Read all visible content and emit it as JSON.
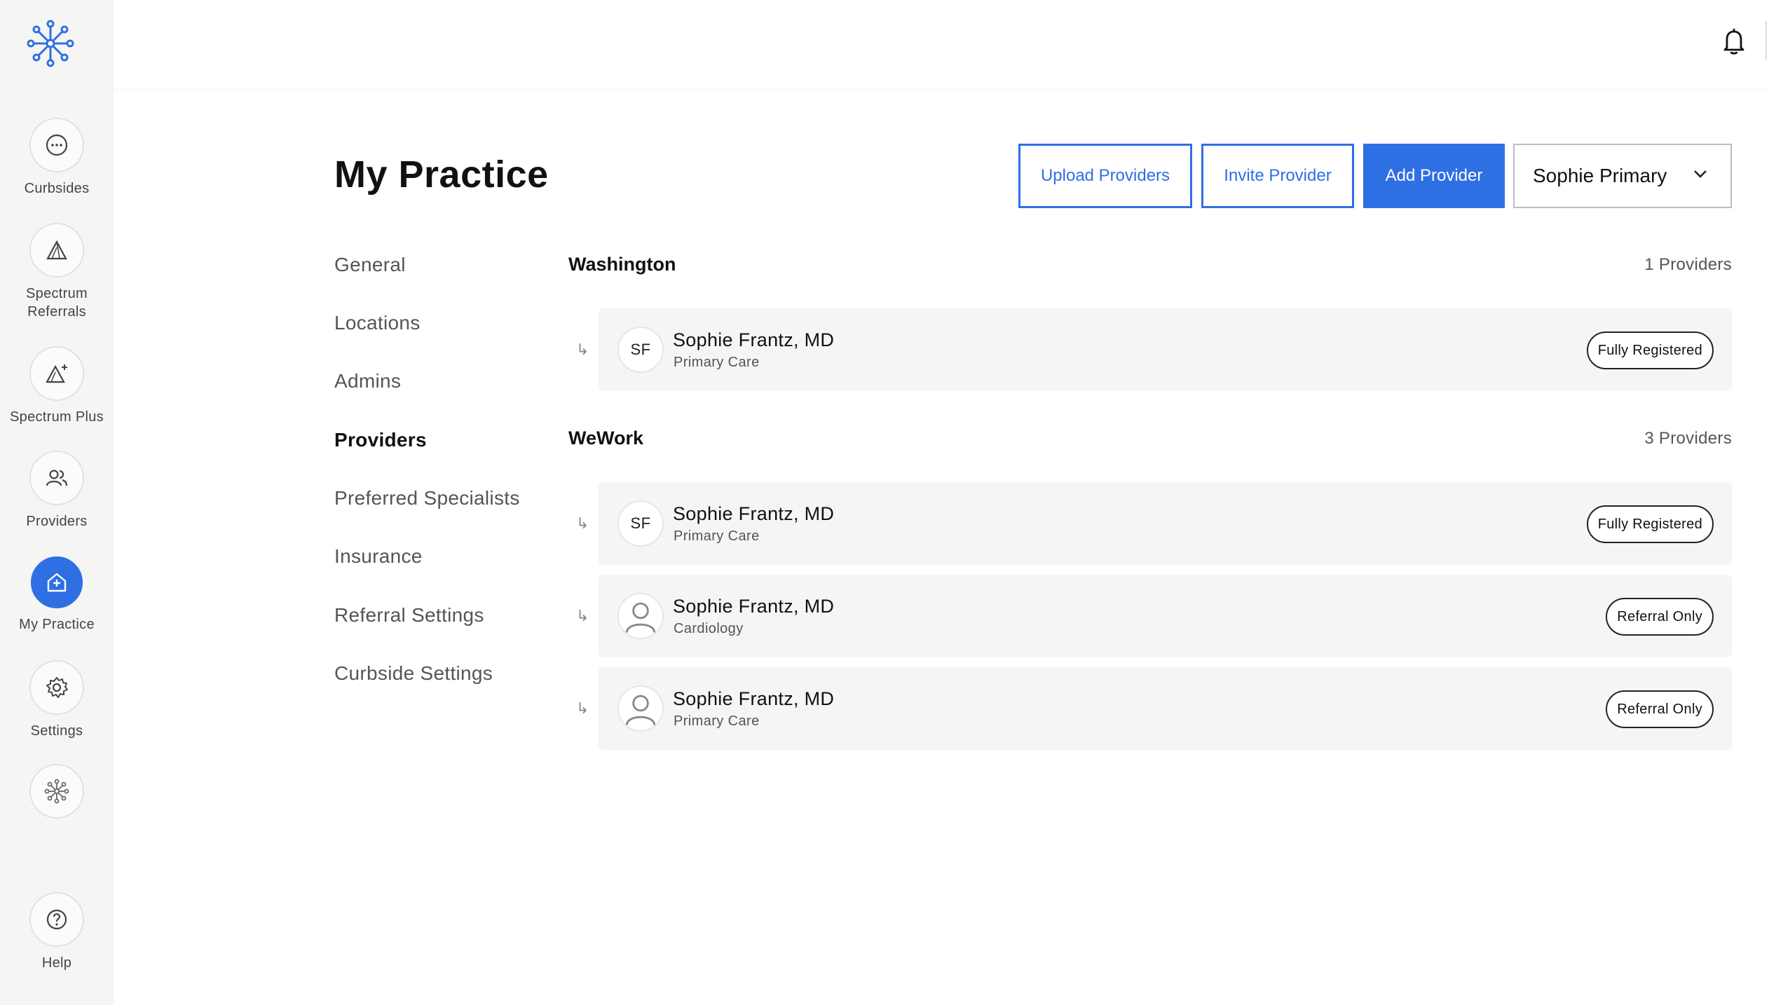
{
  "sidebar": {
    "items": [
      {
        "label": "Curbsides",
        "icon": "chat-bubble-icon"
      },
      {
        "label": "Spectrum\nReferrals",
        "icon": "mountain-icon"
      },
      {
        "label": "Spectrum Plus",
        "icon": "mountain-plus-icon"
      },
      {
        "label": "Providers",
        "icon": "people-icon"
      },
      {
        "label": "My Practice",
        "icon": "house-plus-icon",
        "active": true
      },
      {
        "label": "Settings",
        "icon": "gear-icon"
      },
      {
        "label": "",
        "icon": "network-icon"
      },
      {
        "label": "Help",
        "icon": "help-icon"
      }
    ]
  },
  "header": {
    "title": "My Practice",
    "upload_label": "Upload Providers",
    "invite_label": "Invite Provider",
    "add_label": "Add Provider",
    "account": "Sophie Primary"
  },
  "subnav": {
    "items": [
      "General",
      "Locations",
      "Admins",
      "Providers",
      "Preferred Specialists",
      "Insurance",
      "Referral Settings",
      "Curbside Settings"
    ],
    "active": "Providers"
  },
  "groups": [
    {
      "name": "Washington",
      "count": "1 Providers",
      "providers": [
        {
          "initials": "SF",
          "name": "Sophie Frantz, MD",
          "specialty": "Primary Care",
          "status": "Fully Registered"
        }
      ]
    },
    {
      "name": "WeWork",
      "count": "3 Providers",
      "providers": [
        {
          "initials": "SF",
          "name": "Sophie Frantz, MD",
          "specialty": "Primary Care",
          "status": "Fully Registered"
        },
        {
          "initials": "",
          "name": "Sophie Frantz, MD",
          "specialty": "Cardiology",
          "status": "Referral Only"
        },
        {
          "initials": "",
          "name": "Sophie Frantz, MD",
          "specialty": "Primary Care",
          "status": "Referral Only"
        }
      ]
    }
  ],
  "row_arrow": "↳",
  "colors": {
    "accent": "#2f6fe4",
    "sidebar_bg": "#f5f5f3",
    "card_bg": "#f5f5f3"
  }
}
